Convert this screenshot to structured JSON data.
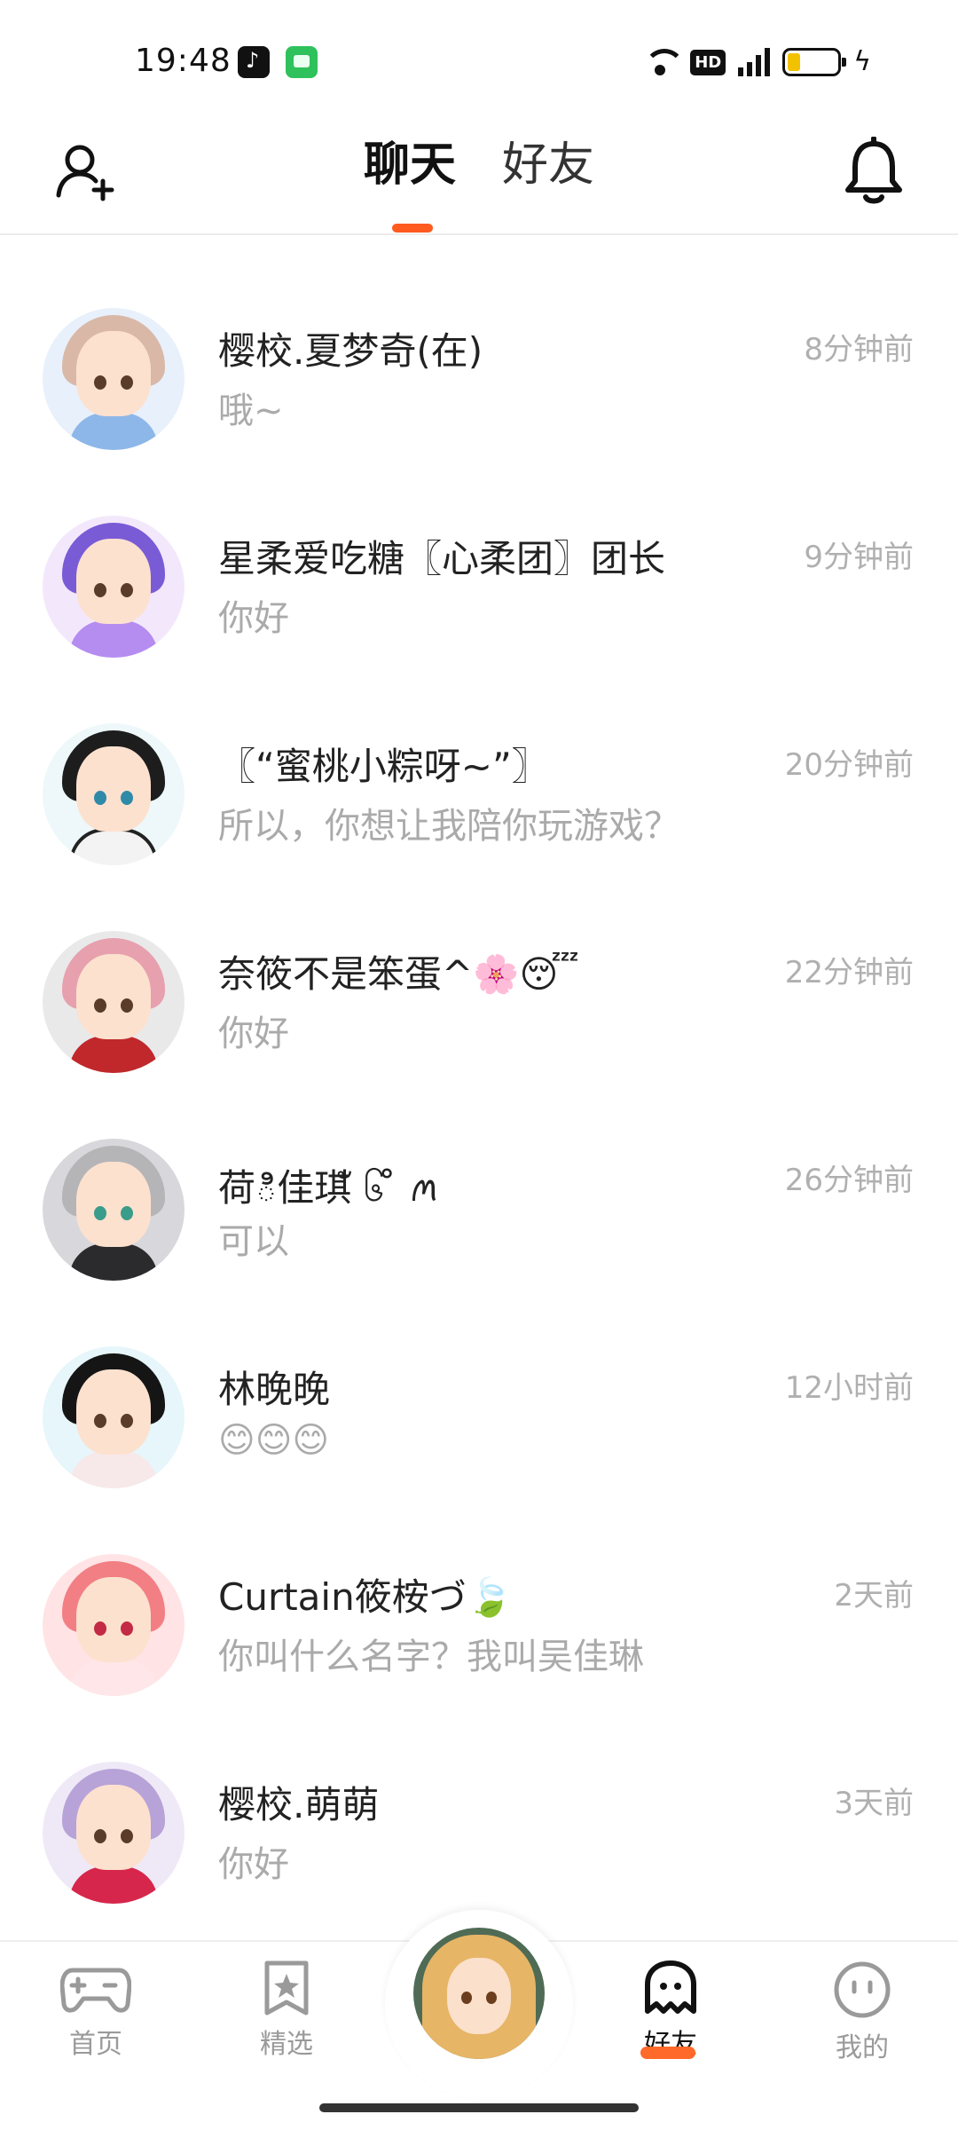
{
  "status_bar": {
    "time": "19:48",
    "apps": [
      "tiktok-icon",
      "message-icon"
    ],
    "indicators": [
      "wifi-icon",
      "hd-icon",
      "signal-4g-icon",
      "battery-icon",
      "charging-icon"
    ],
    "hd_label": "HD"
  },
  "header": {
    "tabs": [
      {
        "label": "聊天",
        "active": true
      },
      {
        "label": "好友",
        "active": false
      }
    ],
    "left_icon": "add-friend-icon",
    "right_icon": "bell-icon",
    "accent_color": "#ff5a1f"
  },
  "chats": [
    {
      "name": "樱校.夏梦奇(在)",
      "preview": "哦~",
      "time": "8分钟前",
      "hair": "#d9b8a8",
      "outfit": "#8db7e8"
    },
    {
      "name": "星柔爱吃糖〖心柔团〗团长",
      "preview": "你好",
      "time": "9分钟前",
      "hair": "#7a5bd6",
      "outfit": "#b58cf0"
    },
    {
      "name": "〖“蜜桃小粽呀~”〗",
      "preview": "所以，你想让我陪你玩游戏？",
      "time": "20分钟前",
      "hair": "#1d1d1d",
      "outfit": "#f3f3f3"
    },
    {
      "name": "奈筱不是笨蛋^🌸😴",
      "preview": "你好",
      "time": "22分钟前",
      "hair": "#e7a0ad",
      "outfit": "#c0282b"
    },
    {
      "name": "荷ి佳琪ั ၆ ̊ ꪔ",
      "preview": "可以",
      "time": "26分钟前",
      "hair": "#b5b5b8",
      "outfit": "#2b2b2e"
    },
    {
      "name": "林晚晚",
      "preview": "😊😊😊",
      "time": "12小时前",
      "hair": "#151515",
      "outfit": "#f7e8ea"
    },
    {
      "name": "Curtain筱桉づ🍃",
      "preview": "你叫什么名字？我叫吴佳琳",
      "time": "2天前",
      "hair": "#f17f84",
      "outfit": "#ffe7e9"
    },
    {
      "name": "樱校.萌萌",
      "preview": "你好",
      "time": "3天前",
      "hair": "#b7a3d8",
      "outfit": "#d7264b"
    }
  ],
  "bottom_nav": [
    {
      "label": "首页",
      "icon": "gamepad-icon",
      "active": false
    },
    {
      "label": "精选",
      "icon": "star-bookmark-icon",
      "active": false
    },
    {
      "label": "",
      "icon": "center-avatar",
      "active": false
    },
    {
      "label": "好友",
      "icon": "ghost-icon",
      "active": true
    },
    {
      "label": "我的",
      "icon": "smiley-face-icon",
      "active": false
    }
  ]
}
